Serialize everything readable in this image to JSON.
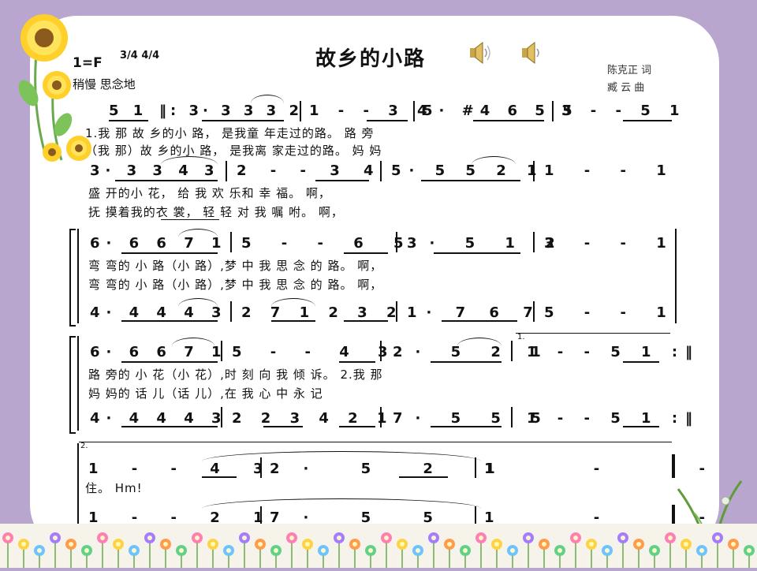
{
  "title": "故乡的小路",
  "key": "1=F",
  "time_sig": [
    "3/4",
    "4/4"
  ],
  "tempo": "稍慢 思念地",
  "credits": {
    "lyricist": "陈克正 词",
    "composer": "臧 云 曲"
  },
  "icons": [
    "speaker-icon",
    "speaker-icon",
    "sunflower-decoration",
    "flower-border",
    "grass-decoration"
  ],
  "lines": {
    "l1_notes": [
      "5 1",
      "‖: 3· 3 3 3 2",
      "1 - - 3 4",
      "5· #4 6 5 5",
      "3 - - 5 1"
    ],
    "l1_lyr_a": "1.我 那  故 乡的小  路，  是我童 年走过的路。  路 旁",
    "l1_lyr_b": "（我 那）故 乡的小  路，  是我离 家走过的路。  妈 妈",
    "l2_notes": [
      "3· 3 3 4 3",
      "2 - - 3 4",
      "5· 5 5 2 1",
      "1 - - 1"
    ],
    "l2_lyr_a": "盛 开的小  花，    给 我  欢 乐和 幸    福。    啊，",
    "l2_lyr_b": "抚 摸着我的衣 裳，     轻 轻  对  我  嘱     咐。    啊，",
    "l3_notes": [
      "6· 6 6 7 1",
      "5 - - 6 5",
      "3· 5 1 2",
      "3 - - 1"
    ],
    "l3_lyr_a": "弯  弯的 小   路（小 路）,梦 中 我 思 念 的  路。    啊，",
    "l3_lyr_b": "弯  弯的 小   路（小 路）,梦 中 我 思 念 的  路。    啊，",
    "l3_harm": [
      "4· 4 4 4 3",
      "2 7 1 2 3 2",
      "1· 7 6 7",
      "5 - - 1"
    ],
    "l4_notes": [
      "6· 6 6 7 1",
      "5 - - 4 3",
      "2· 5 2 1",
      "1 - - 5 1 :‖"
    ],
    "l4_lyr_a": "路  旁的 小   花（小 花）,时 刻 向 我 倾    诉。    2.我 那",
    "l4_lyr_b": "妈  妈的 话   儿（话 儿）,在 我 心 中 永 记",
    "l4_harm": [
      "4· 4 4 4 3",
      "2 2 3 4 2 1",
      "7· 5 5 5",
      "1 - - 5 1 :‖"
    ],
    "l4_volta": "1.",
    "l5_volta": "2.",
    "l5_notes": [
      "1 - - 4 3",
      "2· 5 2 1",
      "1 - -"
    ],
    "l5_lyr_a": "住。      Hm!",
    "l5_harm": [
      "1 - - 2 1",
      "7· 5 5",
      "1 - -"
    ]
  }
}
